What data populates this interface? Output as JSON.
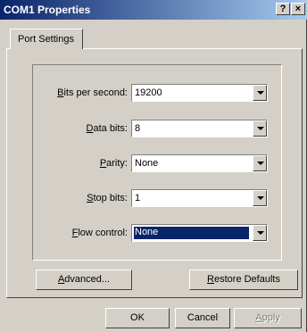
{
  "window": {
    "title": "COM1 Properties",
    "help": "?",
    "close": "×"
  },
  "tab": {
    "label": "Port Settings"
  },
  "fields": [
    {
      "label_key": "B",
      "label_rest": "its per second:",
      "value": "19200"
    },
    {
      "label_key": "D",
      "label_rest": "ata bits:",
      "value": "8"
    },
    {
      "label_key": "P",
      "label_rest": "arity:",
      "value": "None"
    },
    {
      "label_key": "S",
      "label_rest": "top bits:",
      "value": "1"
    },
    {
      "label_key": "F",
      "label_rest": "low control:",
      "value": "None"
    }
  ],
  "buttons": {
    "advanced_key": "A",
    "advanced_rest": "dvanced...",
    "restore_key": "R",
    "restore_rest": "estore Defaults",
    "ok": "OK",
    "cancel": "Cancel",
    "apply_key": "A",
    "apply_rest": "pply"
  }
}
